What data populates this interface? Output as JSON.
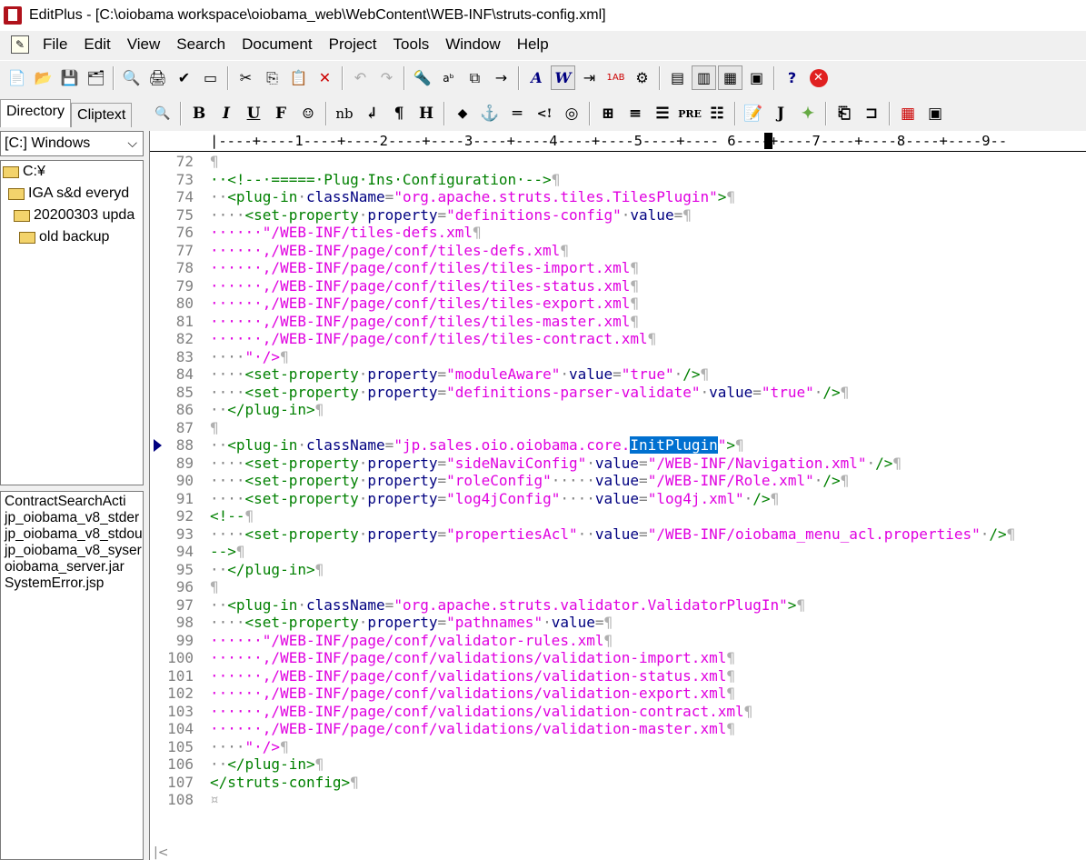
{
  "title": "EditPlus - [C:\\oiobama workspace\\oiobama_web\\WebContent\\WEB-INF\\struts-config.xml]",
  "menu": [
    "File",
    "Edit",
    "View",
    "Search",
    "Document",
    "Project",
    "Tools",
    "Window",
    "Help"
  ],
  "sidebar": {
    "tabs": [
      "Directory",
      "Cliptext"
    ],
    "drive": "[C:] Windows",
    "tree": [
      "C:¥",
      "IGA s&d everyd",
      "20200303 upda",
      "old backup"
    ],
    "files": [
      "ContractSearchActi",
      "jp_oiobama_v8_stder",
      "jp_oiobama_v8_stdou",
      "jp_oiobama_v8_syser",
      "oiobama_server.jar",
      "SystemError.jsp"
    ]
  },
  "ruler": "|----+----1----+----2----+----3----+----4----+----5----+---- 6----+----7----+----8----+----9--",
  "lines": [
    {
      "n": "72",
      "t": ""
    },
    {
      "n": "73",
      "t": "··<!--·=====·Plug·Ins·Configuration·-->"
    },
    {
      "n": "74",
      "t": "··<plug-in·className=\"org.apache.struts.tiles.TilesPlugin\">"
    },
    {
      "n": "75",
      "t": "····<set-property·property=\"definitions-config\"·value="
    },
    {
      "n": "76",
      "t": "······\"/WEB-INF/tiles-defs.xml"
    },
    {
      "n": "77",
      "t": "······,/WEB-INF/page/conf/tiles-defs.xml"
    },
    {
      "n": "78",
      "t": "······,/WEB-INF/page/conf/tiles/tiles-import.xml"
    },
    {
      "n": "79",
      "t": "······,/WEB-INF/page/conf/tiles/tiles-status.xml"
    },
    {
      "n": "80",
      "t": "······,/WEB-INF/page/conf/tiles/tiles-export.xml"
    },
    {
      "n": "81",
      "t": "······,/WEB-INF/page/conf/tiles/tiles-master.xml"
    },
    {
      "n": "82",
      "t": "······,/WEB-INF/page/conf/tiles/tiles-contract.xml"
    },
    {
      "n": "83",
      "t": "····\"·/>"
    },
    {
      "n": "84",
      "t": "····<set-property·property=\"moduleAware\"·value=\"true\"·/>"
    },
    {
      "n": "85",
      "t": "····<set-property·property=\"definitions-parser-validate\"·value=\"true\"·/>"
    },
    {
      "n": "86",
      "t": "··</plug-in>"
    },
    {
      "n": "87",
      "t": ""
    },
    {
      "n": "88",
      "t": "··<plug-in·className=\"jp.sales.oio.oiobama.core.InitPlugin\">"
    },
    {
      "n": "89",
      "t": "····<set-property·property=\"sideNaviConfig\"·value=\"/WEB-INF/Navigation.xml\"·/>"
    },
    {
      "n": "90",
      "t": "····<set-property·property=\"roleConfig\"·····value=\"/WEB-INF/Role.xml\"·/>"
    },
    {
      "n": "91",
      "t": "····<set-property·property=\"log4jConfig\"····value=\"log4j.xml\"·/>"
    },
    {
      "n": "92",
      "t": "<!--"
    },
    {
      "n": "93",
      "t": "····<set-property·property=\"propertiesAcl\"··value=\"/WEB-INF/oiobama_menu_acl.properties\"·/>"
    },
    {
      "n": "94",
      "t": "-->"
    },
    {
      "n": "95",
      "t": "··</plug-in>"
    },
    {
      "n": "96",
      "t": ""
    },
    {
      "n": "97",
      "t": "··<plug-in·className=\"org.apache.struts.validator.ValidatorPlugIn\">"
    },
    {
      "n": "98",
      "t": "····<set-property·property=\"pathnames\"·value="
    },
    {
      "n": "99",
      "t": "······\"/WEB-INF/page/conf/validator-rules.xml"
    },
    {
      "n": "100",
      "t": "······,/WEB-INF/page/conf/validations/validation-import.xml"
    },
    {
      "n": "101",
      "t": "······,/WEB-INF/page/conf/validations/validation-status.xml"
    },
    {
      "n": "102",
      "t": "······,/WEB-INF/page/conf/validations/validation-export.xml"
    },
    {
      "n": "103",
      "t": "······,/WEB-INF/page/conf/validations/validation-contract.xml"
    },
    {
      "n": "104",
      "t": "······,/WEB-INF/page/conf/validations/validation-master.xml"
    },
    {
      "n": "105",
      "t": "····\"·/>"
    },
    {
      "n": "106",
      "t": "··</plug-in>"
    },
    {
      "n": "107",
      "t": "</struts-config>"
    },
    {
      "n": "108",
      "t": ""
    }
  ],
  "current_line": "88",
  "selection": "InitPlugin",
  "colors": {
    "tag": "#008000",
    "attr": "#000080",
    "value": "#e000e0",
    "selection": "#0070d0"
  }
}
